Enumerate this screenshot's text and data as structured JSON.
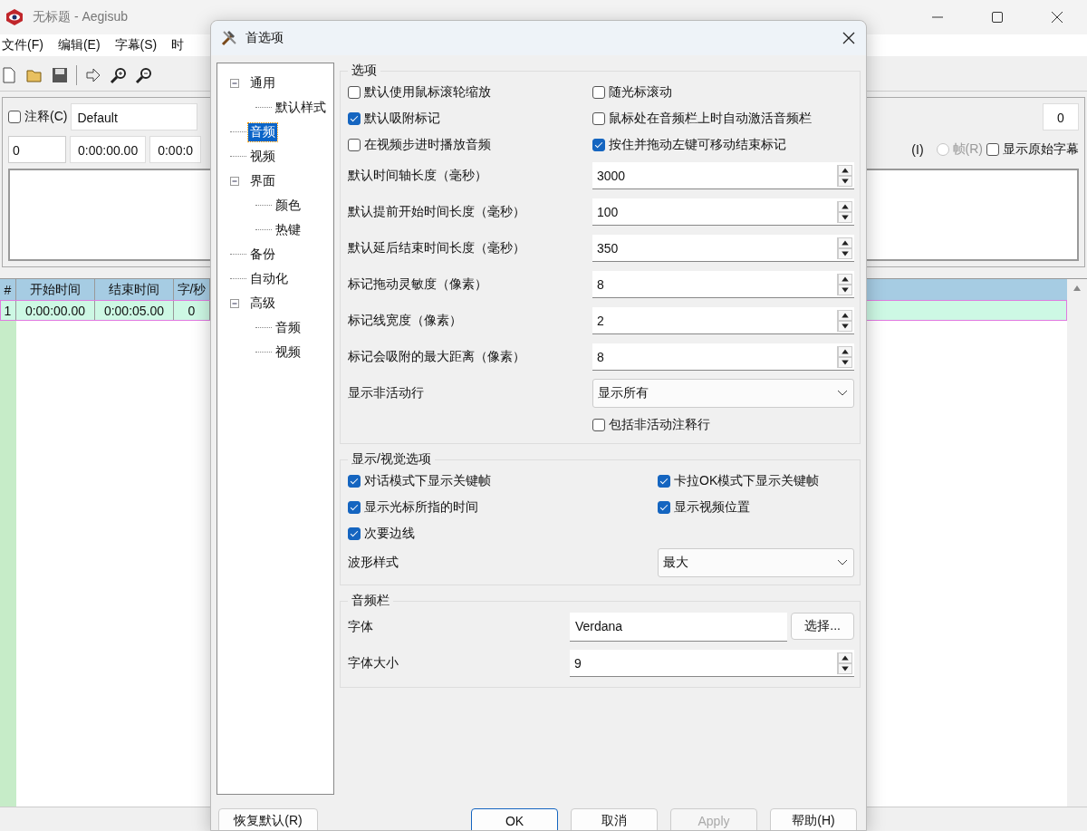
{
  "app": {
    "title": "无标题 - Aegisub",
    "menu": [
      "文件(F)",
      "编辑(E)",
      "字幕(S)",
      "时"
    ],
    "editor": {
      "comment": {
        "label": "注释(C)",
        "checked": false
      },
      "style": "Default",
      "layer": "0",
      "line": "0",
      "start_time": "0:00:00.00",
      "end_time": "0:00:0",
      "mode_tail": "(I)",
      "frame_radio": {
        "label": "帧(R)",
        "selected": false,
        "disabled": true
      },
      "show_original": {
        "label": "显示原始字幕",
        "checked": false
      }
    },
    "grid": {
      "columns": [
        "#",
        "开始时间",
        "结束时间",
        "字/秒"
      ],
      "rows": [
        {
          "cells": [
            "1",
            "0:00:00.00",
            "0:00:05.00",
            "0"
          ],
          "selected": true
        }
      ]
    }
  },
  "dialog": {
    "title": "首选项",
    "tree": [
      {
        "label": "通用",
        "selected": false,
        "expanded": true,
        "children": [
          {
            "label": "默认样式",
            "selected": false
          }
        ]
      },
      {
        "label": "音频",
        "selected": true
      },
      {
        "label": "视频",
        "selected": false
      },
      {
        "label": "界面",
        "selected": false,
        "expanded": true,
        "children": [
          {
            "label": "颜色",
            "selected": false
          },
          {
            "label": "热键",
            "selected": false
          }
        ]
      },
      {
        "label": "备份",
        "selected": false
      },
      {
        "label": "自动化",
        "selected": false
      },
      {
        "label": "高级",
        "selected": false,
        "expanded": true,
        "children": [
          {
            "label": "音频",
            "selected": false
          },
          {
            "label": "视频",
            "selected": false
          }
        ]
      }
    ],
    "groups": [
      {
        "title": "选项",
        "rows": [
          {
            "kind": "checks",
            "items": [
              {
                "label": "默认使用鼠标滚轮缩放",
                "checked": false
              },
              {
                "label": "随光标滚动",
                "checked": false
              }
            ]
          },
          {
            "kind": "checks",
            "items": [
              {
                "label": "默认吸附标记",
                "checked": true
              },
              {
                "label": "鼠标处在音频栏上时自动激活音频栏",
                "checked": false
              }
            ]
          },
          {
            "kind": "checks",
            "items": [
              {
                "label": "在视频步进时播放音频",
                "checked": false
              },
              {
                "label": "按住并拖动左键可移动结束标记",
                "checked": true
              }
            ]
          },
          {
            "kind": "spin",
            "label": "默认时间轴长度（毫秒）",
            "value": "3000"
          },
          {
            "kind": "spin",
            "label": "默认提前开始时间长度（毫秒）",
            "value": "100"
          },
          {
            "kind": "spin",
            "label": "默认延后结束时间长度（毫秒）",
            "value": "350"
          },
          {
            "kind": "spin",
            "label": "标记拖动灵敏度（像素）",
            "value": "8"
          },
          {
            "kind": "spin",
            "label": "标记线宽度（像素）",
            "value": "2"
          },
          {
            "kind": "spin",
            "label": "标记会吸附的最大距离（像素）",
            "value": "8"
          },
          {
            "kind": "dropdown",
            "label": "显示非活动行",
            "value": "显示所有"
          },
          {
            "kind": "check_right",
            "items": [
              {
                "label": "包括非活动注释行",
                "checked": false
              }
            ]
          }
        ]
      },
      {
        "title": "显示/视觉选项",
        "rows": [
          {
            "kind": "checks",
            "items": [
              {
                "label": "对话模式下显示关键帧",
                "checked": true
              },
              {
                "label": "卡拉OK模式下显示关键帧",
                "checked": true
              }
            ]
          },
          {
            "kind": "checks",
            "items": [
              {
                "label": "显示光标所指的时间",
                "checked": true
              },
              {
                "label": "显示视频位置",
                "checked": true
              }
            ]
          },
          {
            "kind": "checks",
            "items": [
              {
                "label": "次要边线",
                "checked": true
              }
            ]
          },
          {
            "kind": "dropdown",
            "label": "波形样式",
            "value": "最大"
          }
        ]
      },
      {
        "title": "音频栏",
        "rows": [
          {
            "kind": "font",
            "label": "字体",
            "value": "Verdana",
            "button": "选择..."
          },
          {
            "kind": "spin",
            "label": "字体大小",
            "value": "9"
          }
        ]
      }
    ],
    "reset_button": "恢复默认(R)",
    "buttons": [
      {
        "label": "OK",
        "kind": "default",
        "disabled": false
      },
      {
        "label": "取消",
        "kind": "normal",
        "disabled": false
      },
      {
        "label": "Apply",
        "kind": "normal",
        "disabled": true
      },
      {
        "label": "帮助(H)",
        "kind": "normal",
        "disabled": false
      }
    ]
  }
}
